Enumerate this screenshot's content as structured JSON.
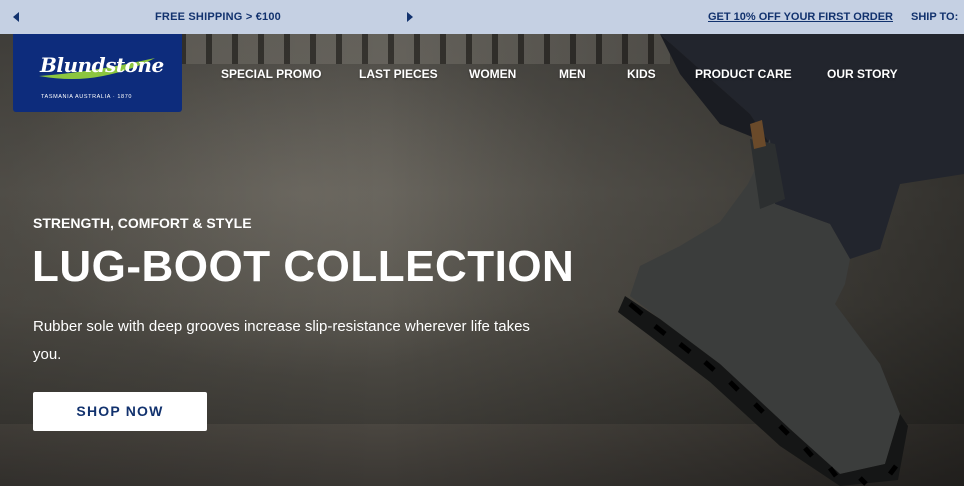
{
  "promo_bar": {
    "message": "FREE SHIPPING > €100",
    "offer_link": "GET 10% OFF YOUR FIRST ORDER",
    "ship_to": "SHIP TO:"
  },
  "logo": {
    "wordmark": "Blundstone",
    "tagline": "TASMANIA AUSTRALIA · 1870"
  },
  "nav": {
    "items": [
      "SPECIAL PROMO",
      "LAST PIECES",
      "WOMEN",
      "MEN",
      "KIDS",
      "PRODUCT CARE",
      "OUR STORY"
    ]
  },
  "hero": {
    "eyebrow": "STRENGTH, COMFORT & STYLE",
    "title": "LUG-BOOT COLLECTION",
    "description": "Rubber sole with deep grooves increase slip-resistance wherever life takes you.",
    "cta": "SHOP NOW"
  },
  "colors": {
    "promo_bar_bg": "#c5d0e3",
    "brand_navy": "#0d2c7c",
    "promo_text": "#12326e",
    "logo_swoosh": "#8cc63f"
  }
}
